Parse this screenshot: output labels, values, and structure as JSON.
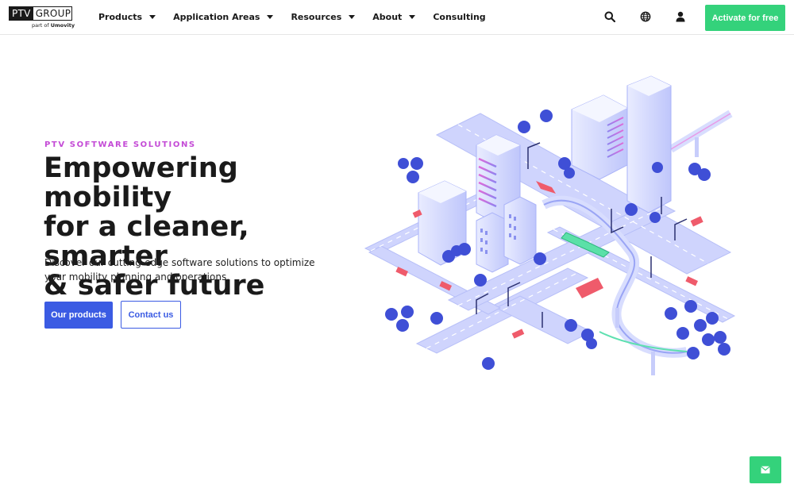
{
  "header": {
    "logo": {
      "left": "PTV",
      "right": "GROUP",
      "sub_prefix": "part of",
      "sub_brand": "Umovity"
    },
    "nav": [
      {
        "label": "Products",
        "has_dropdown": true
      },
      {
        "label": "Application Areas",
        "has_dropdown": true
      },
      {
        "label": "Resources",
        "has_dropdown": true
      },
      {
        "label": "About",
        "has_dropdown": true
      },
      {
        "label": "Consulting",
        "has_dropdown": false
      }
    ],
    "icons": [
      "search-icon",
      "globe-icon",
      "user-icon"
    ],
    "cta_label": "Activate for free"
  },
  "hero": {
    "eyebrow": "PTV SOFTWARE SOLUTIONS",
    "headline_line1": "Empowering mobility",
    "headline_line2": "for a cleaner, smarter",
    "headline_line3": "& safer future",
    "subtext": "Discover our cutting-edge software solutions to optimize your mobility planning and operations.",
    "primary_button": "Our products",
    "secondary_button": "Contact us"
  },
  "floating": {
    "icon": "mail-icon"
  },
  "colors": {
    "accent_green": "#34d27b",
    "primary_blue": "#3b5be3",
    "eyebrow_magenta": "#c44bd6",
    "text_dark": "#1a1a1a"
  }
}
